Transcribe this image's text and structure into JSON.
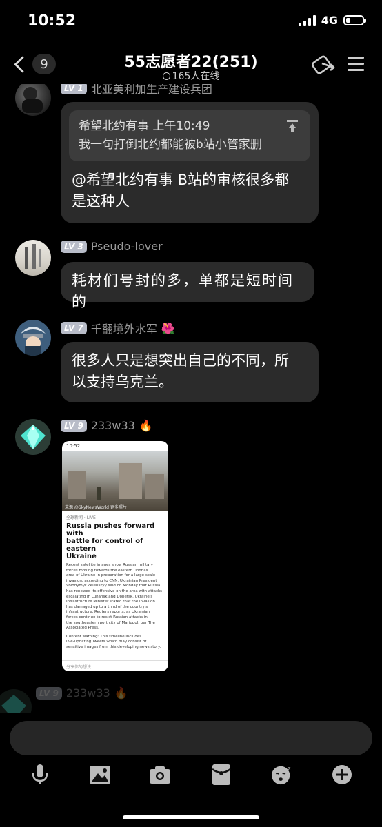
{
  "status_bar": {
    "time": "10:52",
    "network": "4G"
  },
  "header": {
    "back_count": "9",
    "title": "55志愿者22(251)",
    "online": "165人在线"
  },
  "messages": [
    {
      "level": "LV 1",
      "name": "北亚美利加生产建设兵团",
      "quote_sender": "希望北约有事 上午10:49",
      "quote_text": "我一句打倒北约都能被b站小管家删",
      "text_line1": "@希望北约有事 B站的审核很多都",
      "text_line2": "是这种人"
    },
    {
      "level": "LV 3",
      "name": "Pseudo-lover",
      "text": "耗材们号封的多，单都是短时间的"
    },
    {
      "level": "LV 7",
      "name": "千翻境外水军",
      "badge": "🌺",
      "text_line1": "很多人只是想突出自己的不同，所",
      "text_line2": "以支持乌克兰。"
    },
    {
      "level": "LV 9",
      "name": "233w33",
      "badge": "🔥",
      "screenshot": {
        "time": "10:52",
        "caption": "来源 @SkyNewsWorld 更多照片",
        "tag": "全球新闻 · LIVE",
        "headline_1": "Russia pushes forward with",
        "headline_2": "battle for control of eastern",
        "headline_3": "Ukraine",
        "body": [
          "Recent satellite images show Russian military",
          "forces moving towards the eastern Donbas",
          "area of Ukraine in preparation for a large-scale",
          "invasion, according to CNN. Ukrainian President",
          "Volodymyr Zelenskyy said on Monday that Russia",
          "has renewed its offensive on the area with attacks",
          "escalating in Luhansk and Donetsk. Ukraine's",
          "Infrastructure Minister stated that the invasion",
          "has damaged up to a third of the country's",
          "infrastructure, Reuters reports, as Ukrainian",
          "forces continue to resist Russian attacks in",
          "the southeastern port city of Mariupol, per The",
          "Associated Press."
        ],
        "warning": [
          "Content warning: This timeline includes",
          "live-updating Tweets which may consist of",
          "sensitive images from this developing news story."
        ],
        "input_placeholder": "分享你的想法"
      }
    },
    {
      "level": "LV 9",
      "name": "233w33",
      "badge": "🔥"
    }
  ],
  "toolbar": [
    "microphone-icon",
    "image-icon",
    "camera-icon",
    "red-packet-icon",
    "emoji-icon",
    "plus-icon"
  ]
}
